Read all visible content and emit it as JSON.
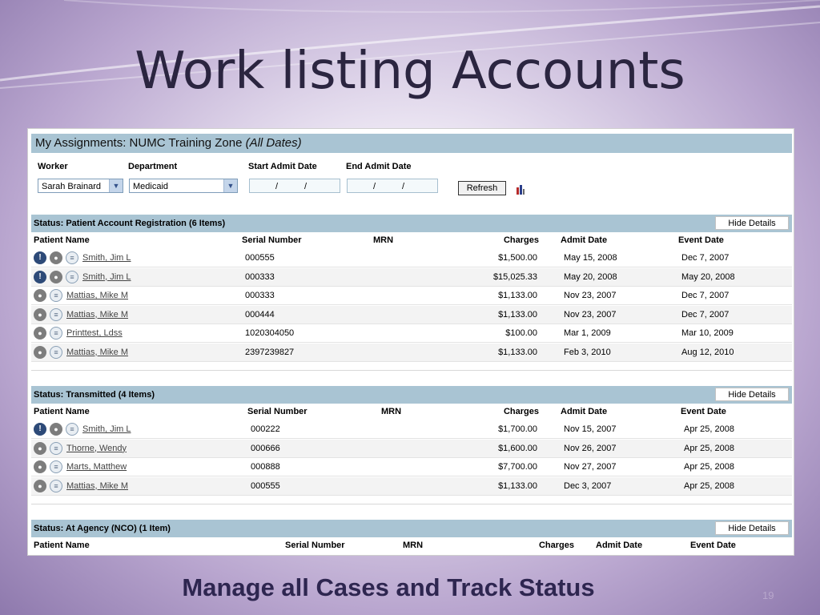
{
  "slide": {
    "title": "Work listing Accounts",
    "subtitle": "Manage all Cases and Track Status",
    "page_number": "19"
  },
  "header": {
    "title_prefix": "My Assignments: NUMC Training Zone ",
    "title_em": "(All Dates)"
  },
  "filters": {
    "worker_label": "Worker",
    "worker_value": "Sarah Brainard",
    "department_label": "Department",
    "department_value": "Medicaid",
    "start_label": "Start Admit Date",
    "end_label": "End Admit Date",
    "date_sep": "/",
    "refresh_label": "Refresh"
  },
  "columns": {
    "patient": "Patient Name",
    "serial": "Serial Number",
    "mrn": "MRN",
    "charges": "Charges",
    "admit": "Admit Date",
    "event": "Event Date"
  },
  "hide_label": "Hide Details",
  "sections": [
    {
      "status": "Status: Patient Account Registration (6 Items)",
      "rows": [
        {
          "alert": true,
          "name": "Smith, Jim L",
          "serial": "000555",
          "mrn": "",
          "charges": "$1,500.00",
          "admit": "May 15, 2008",
          "event": "Dec 7, 2007"
        },
        {
          "alert": true,
          "name": "Smith, Jim L",
          "serial": "000333",
          "mrn": "",
          "charges": "$15,025.33",
          "admit": "May 20, 2008",
          "event": "May 20, 2008"
        },
        {
          "alert": false,
          "name": "Mattias, Mike M",
          "serial": "000333",
          "mrn": "",
          "charges": "$1,133.00",
          "admit": "Nov 23, 2007",
          "event": "Dec 7, 2007"
        },
        {
          "alert": false,
          "name": "Mattias, Mike M",
          "serial": "000444",
          "mrn": "",
          "charges": "$1,133.00",
          "admit": "Nov 23, 2007",
          "event": "Dec 7, 2007"
        },
        {
          "alert": false,
          "name": "Printtest, Ldss",
          "serial": "1020304050",
          "mrn": "",
          "charges": "$100.00",
          "admit": "Mar 1, 2009",
          "event": "Mar 10, 2009"
        },
        {
          "alert": false,
          "name": "Mattias, Mike M",
          "serial": "2397239827",
          "mrn": "",
          "charges": "$1,133.00",
          "admit": "Feb 3, 2010",
          "event": "Aug 12, 2010"
        }
      ]
    },
    {
      "status": "Status: Transmitted (4 Items)",
      "rows": [
        {
          "alert": true,
          "name": "Smith, Jim L",
          "serial": "000222",
          "mrn": "",
          "charges": "$1,700.00",
          "admit": "Nov 15, 2007",
          "event": "Apr 25, 2008"
        },
        {
          "alert": false,
          "name": "Thorne, Wendy",
          "serial": "000666",
          "mrn": "",
          "charges": "$1,600.00",
          "admit": "Nov 26, 2007",
          "event": "Apr 25, 2008"
        },
        {
          "alert": false,
          "name": "Marts, Matthew",
          "serial": "000888",
          "mrn": "",
          "charges": "$7,700.00",
          "admit": "Nov 27, 2007",
          "event": "Apr 25, 2008"
        },
        {
          "alert": false,
          "name": "Mattias, Mike M",
          "serial": "000555",
          "mrn": "",
          "charges": "$1,133.00",
          "admit": "Dec 3, 2007",
          "event": "Apr 25, 2008"
        }
      ]
    },
    {
      "status": "Status: At Agency (NCO) (1 Item)",
      "rows": []
    }
  ],
  "icons": {
    "alert": "exclamation-icon",
    "person": "person-icon",
    "note": "note-icon",
    "chart": "bar-chart-icon"
  },
  "colors": {
    "header_bar": "#a9c4d3",
    "alert_icon": "#2d4a78",
    "title_text": "#2b2540"
  }
}
